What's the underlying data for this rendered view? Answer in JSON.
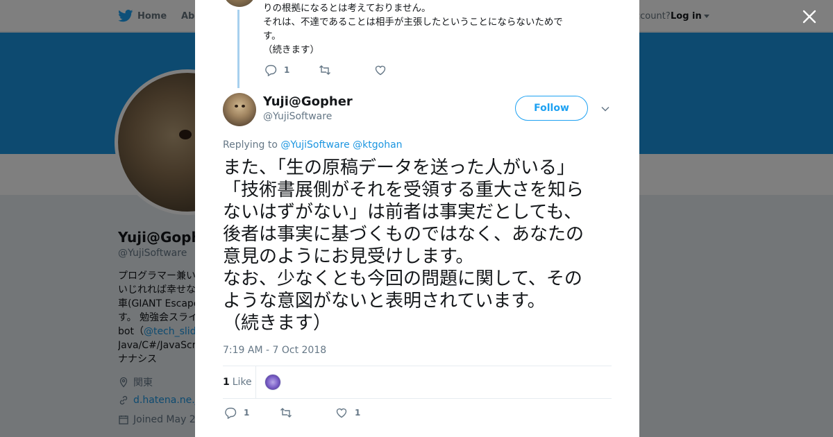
{
  "colors": {
    "twitter_blue": "#1da1f2",
    "banner": "#1b95e0",
    "link": "#1b95e0",
    "muted": "#657786",
    "thread_line": "#a7d0ee"
  },
  "topbar": {
    "home_label": "Home",
    "about_label": "Abo",
    "account_label": "ccount?",
    "login_label": "Log in"
  },
  "profile": {
    "name": "Yuji@Goph",
    "handle": "@YujiSoftware",
    "bio_lines": [
      "プログラマー兼い",
      "いじれれば幸せな",
      "車(GIANT Escape",
      "す。 勉強会スライ"
    ],
    "bio_bot_prefix": "bot（",
    "bio_bot_link": "@tech_slide",
    "bio_tail": [
      "Java/C#/JavaScrip",
      "ナナシス"
    ],
    "location": "関東",
    "website": "d.hatena.ne.jp",
    "joined": "Joined May 20"
  },
  "prev_tweet": {
    "lines": [
      "りの根拠になるとは考えておりません。",
      "それは、不達であることは相手が主張したということにならないためで",
      "す。",
      "（続きます）"
    ],
    "reply_count": "1",
    "retweet_count": "",
    "like_count": ""
  },
  "tweet": {
    "author_name": "Yuji@Gopher",
    "author_handle": "@YujiSoftware",
    "follow_label": "Follow",
    "replying_prefix": "Replying to",
    "replying_to": [
      "@YujiSoftware",
      "@ktgohan"
    ],
    "text_lines": [
      "また、「生の原稿データを送った人がいる」",
      "「技術書展側がそれを受領する重大さを知ら",
      "ないはずがない」は前者は事実だとしても、",
      "後者は事実に基づくものではなく、あなたの",
      "意見のようにお見受けします。",
      "なお、少なくとも今回の問題に関して、その",
      "ような意図がないと表明されています。",
      "（続きます）"
    ],
    "timestamp": "7:19 AM - 7 Oct 2018",
    "likes_count": "1",
    "likes_label": "Like",
    "reply_count": "1",
    "retweet_count": "",
    "like_count": "1"
  },
  "icons": {
    "close": "close-icon",
    "reply": "reply-icon",
    "retweet": "retweet-icon",
    "like": "heart-icon",
    "chevron": "chevron-down-icon",
    "bird": "twitter-bird-icon"
  }
}
